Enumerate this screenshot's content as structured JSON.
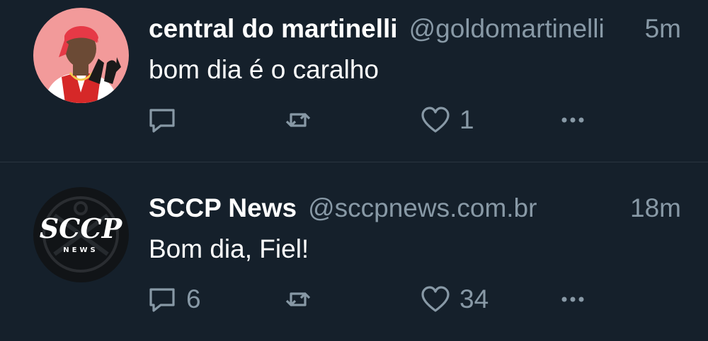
{
  "colors": {
    "background": "#15202b",
    "name": "#ffffff",
    "secondary": "#8899a6",
    "divider": "#2a3540"
  },
  "tweets": [
    {
      "avatar_icon": "red-bandana-avatar-icon",
      "display_name": "central do martinelli",
      "handle": "@goldomartinelli",
      "time": "5m",
      "text": "bom dia é o caralho",
      "reply_count": "",
      "retweet_count": "",
      "like_count": "1"
    },
    {
      "avatar_icon": "sccp-news-logo-icon",
      "avatar_logo_text": "SCCP",
      "avatar_logo_subtext": "NEWS",
      "display_name": "SCCP News",
      "handle": "@sccpnews.com.br",
      "time": "18m",
      "text": "Bom dia, Fiel!",
      "reply_count": "6",
      "retweet_count": "",
      "like_count": "34"
    }
  ]
}
